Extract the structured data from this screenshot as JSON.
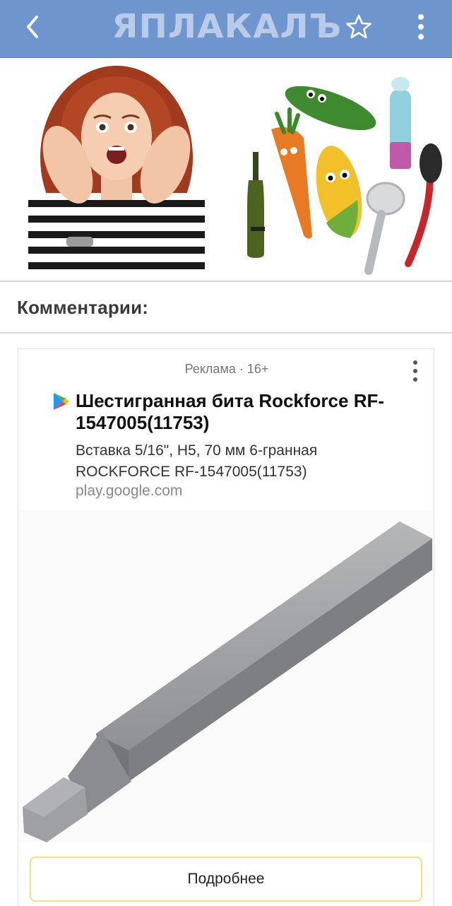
{
  "header": {
    "logo_text": "ЯПЛАКАЛЪ",
    "background": "#6f95cf",
    "back_icon": "chevron-left-icon",
    "star_icon": "star-outline-icon",
    "more_icon": "more-vertical-icon"
  },
  "promo": {
    "left_image": "surprised-woman",
    "right_image": "cartoon-objects"
  },
  "comments": {
    "title": "Комментарии:"
  },
  "ad": {
    "label": "Реклама · 16+",
    "store_icon": "google-play-icon",
    "headline": "Шестигранная бита Rockforce RF-1547005(11753)",
    "description": "Вставка 5/16\", H5, 70 мм 6-гранная ROCKFORCE RF-1547005(11753)",
    "domain": "play.google.com",
    "cta_label": "Подробнее",
    "cta_border": "#f4e08a"
  }
}
